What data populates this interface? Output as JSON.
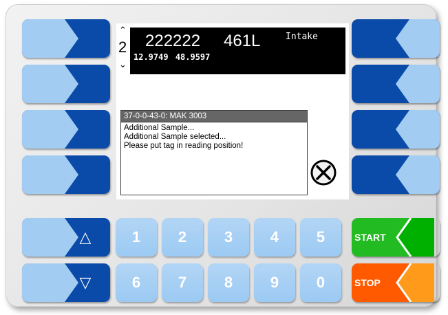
{
  "screen": {
    "scroll_up_icon": "chevron-up-icon",
    "scroll_down_icon": "chevron-down-icon",
    "line_number": "2",
    "info": {
      "id": "222222",
      "volume": "461L",
      "mode": "Intake",
      "coord_a": "12.9749",
      "coord_b": "48.9597"
    },
    "message": {
      "title": "37-0-0-43-0: MAK 3003",
      "lines": [
        "Additional Sample...",
        "Additional Sample selected...",
        "Please put tag in reading position!"
      ]
    },
    "cancel_icon": "x-circle-icon"
  },
  "left_softkeys": [
    {
      "icon": "arrow-right-icon"
    },
    {
      "icon": "arrow-right-icon"
    },
    {
      "icon": "arrow-right-icon"
    },
    {
      "icon": "arrow-right-icon"
    }
  ],
  "right_softkeys": [
    {
      "icon": "arrow-left-icon"
    },
    {
      "icon": "arrow-left-icon"
    },
    {
      "icon": "arrow-left-icon"
    },
    {
      "icon": "arrow-left-icon"
    }
  ],
  "nav_keys": {
    "up_symbol": "△",
    "down_symbol": "▽"
  },
  "number_keys": {
    "row1": [
      "1",
      "2",
      "3",
      "4",
      "5"
    ],
    "row2": [
      "6",
      "7",
      "8",
      "9",
      "0"
    ]
  },
  "action_keys": {
    "start_label": "START",
    "stop_label": "STOP",
    "start_color": "#22bb22",
    "stop_color": "#ff7a00"
  },
  "colors": {
    "softkey_light": "#9fcaf1",
    "softkey_dark": "#0a4aa8",
    "numkey": "#a8d0f4"
  }
}
